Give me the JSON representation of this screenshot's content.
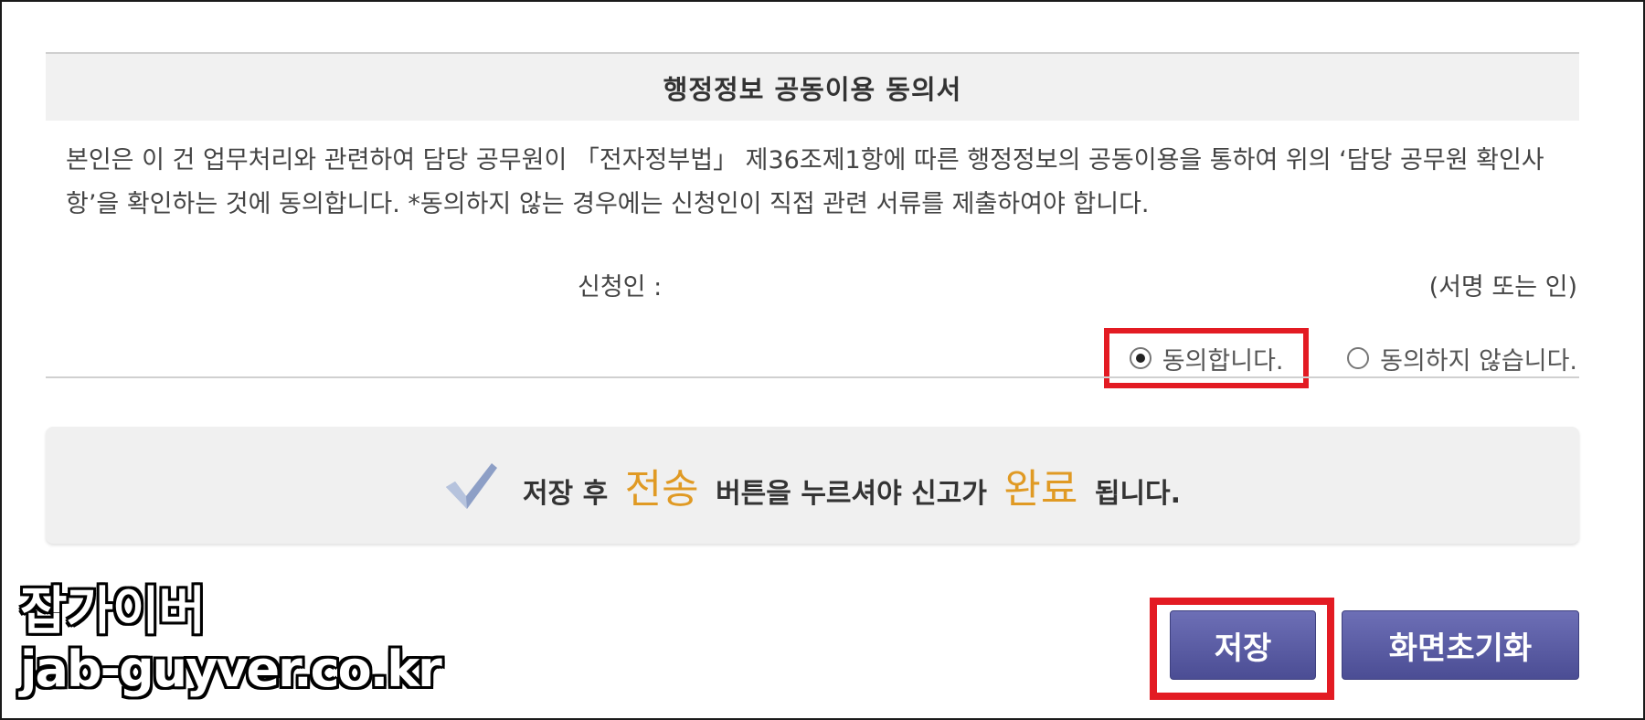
{
  "consent": {
    "title": "행정정보 공동이용 동의서",
    "body": "본인은 이 건 업무처리와 관련하여 담당 공무원이 「전자정부법」 제36조제1항에 따른 행정정보의 공동이용을 통하여 위의 ‘담당 공무원 확인사항’을 확인하는 것에 동의합니다. *동의하지 않는 경우에는 신청인이 직접 관련 서류를 제출하여야 합니다.",
    "applicant_label": "신청인 :",
    "sign_hint": "(서명 또는 인)",
    "options": [
      {
        "label": "동의합니다.",
        "selected": true
      },
      {
        "label": "동의하지 않습니다.",
        "selected": false
      }
    ]
  },
  "notice": {
    "icon": "check-icon",
    "part1": "저장 후",
    "em1": "전송",
    "part2": "버튼을 누르셔야 신고가",
    "em2": "완료",
    "part3": "됩니다.",
    "accent_color": "#e09a24"
  },
  "buttons": {
    "save_label": "저장",
    "reset_label": "화면초기화"
  },
  "watermark": {
    "line1": "잡가이버",
    "line2": "jab-guyver.co.kr"
  },
  "colors": {
    "highlight": "#e31b23",
    "button": "#5b5da3"
  }
}
